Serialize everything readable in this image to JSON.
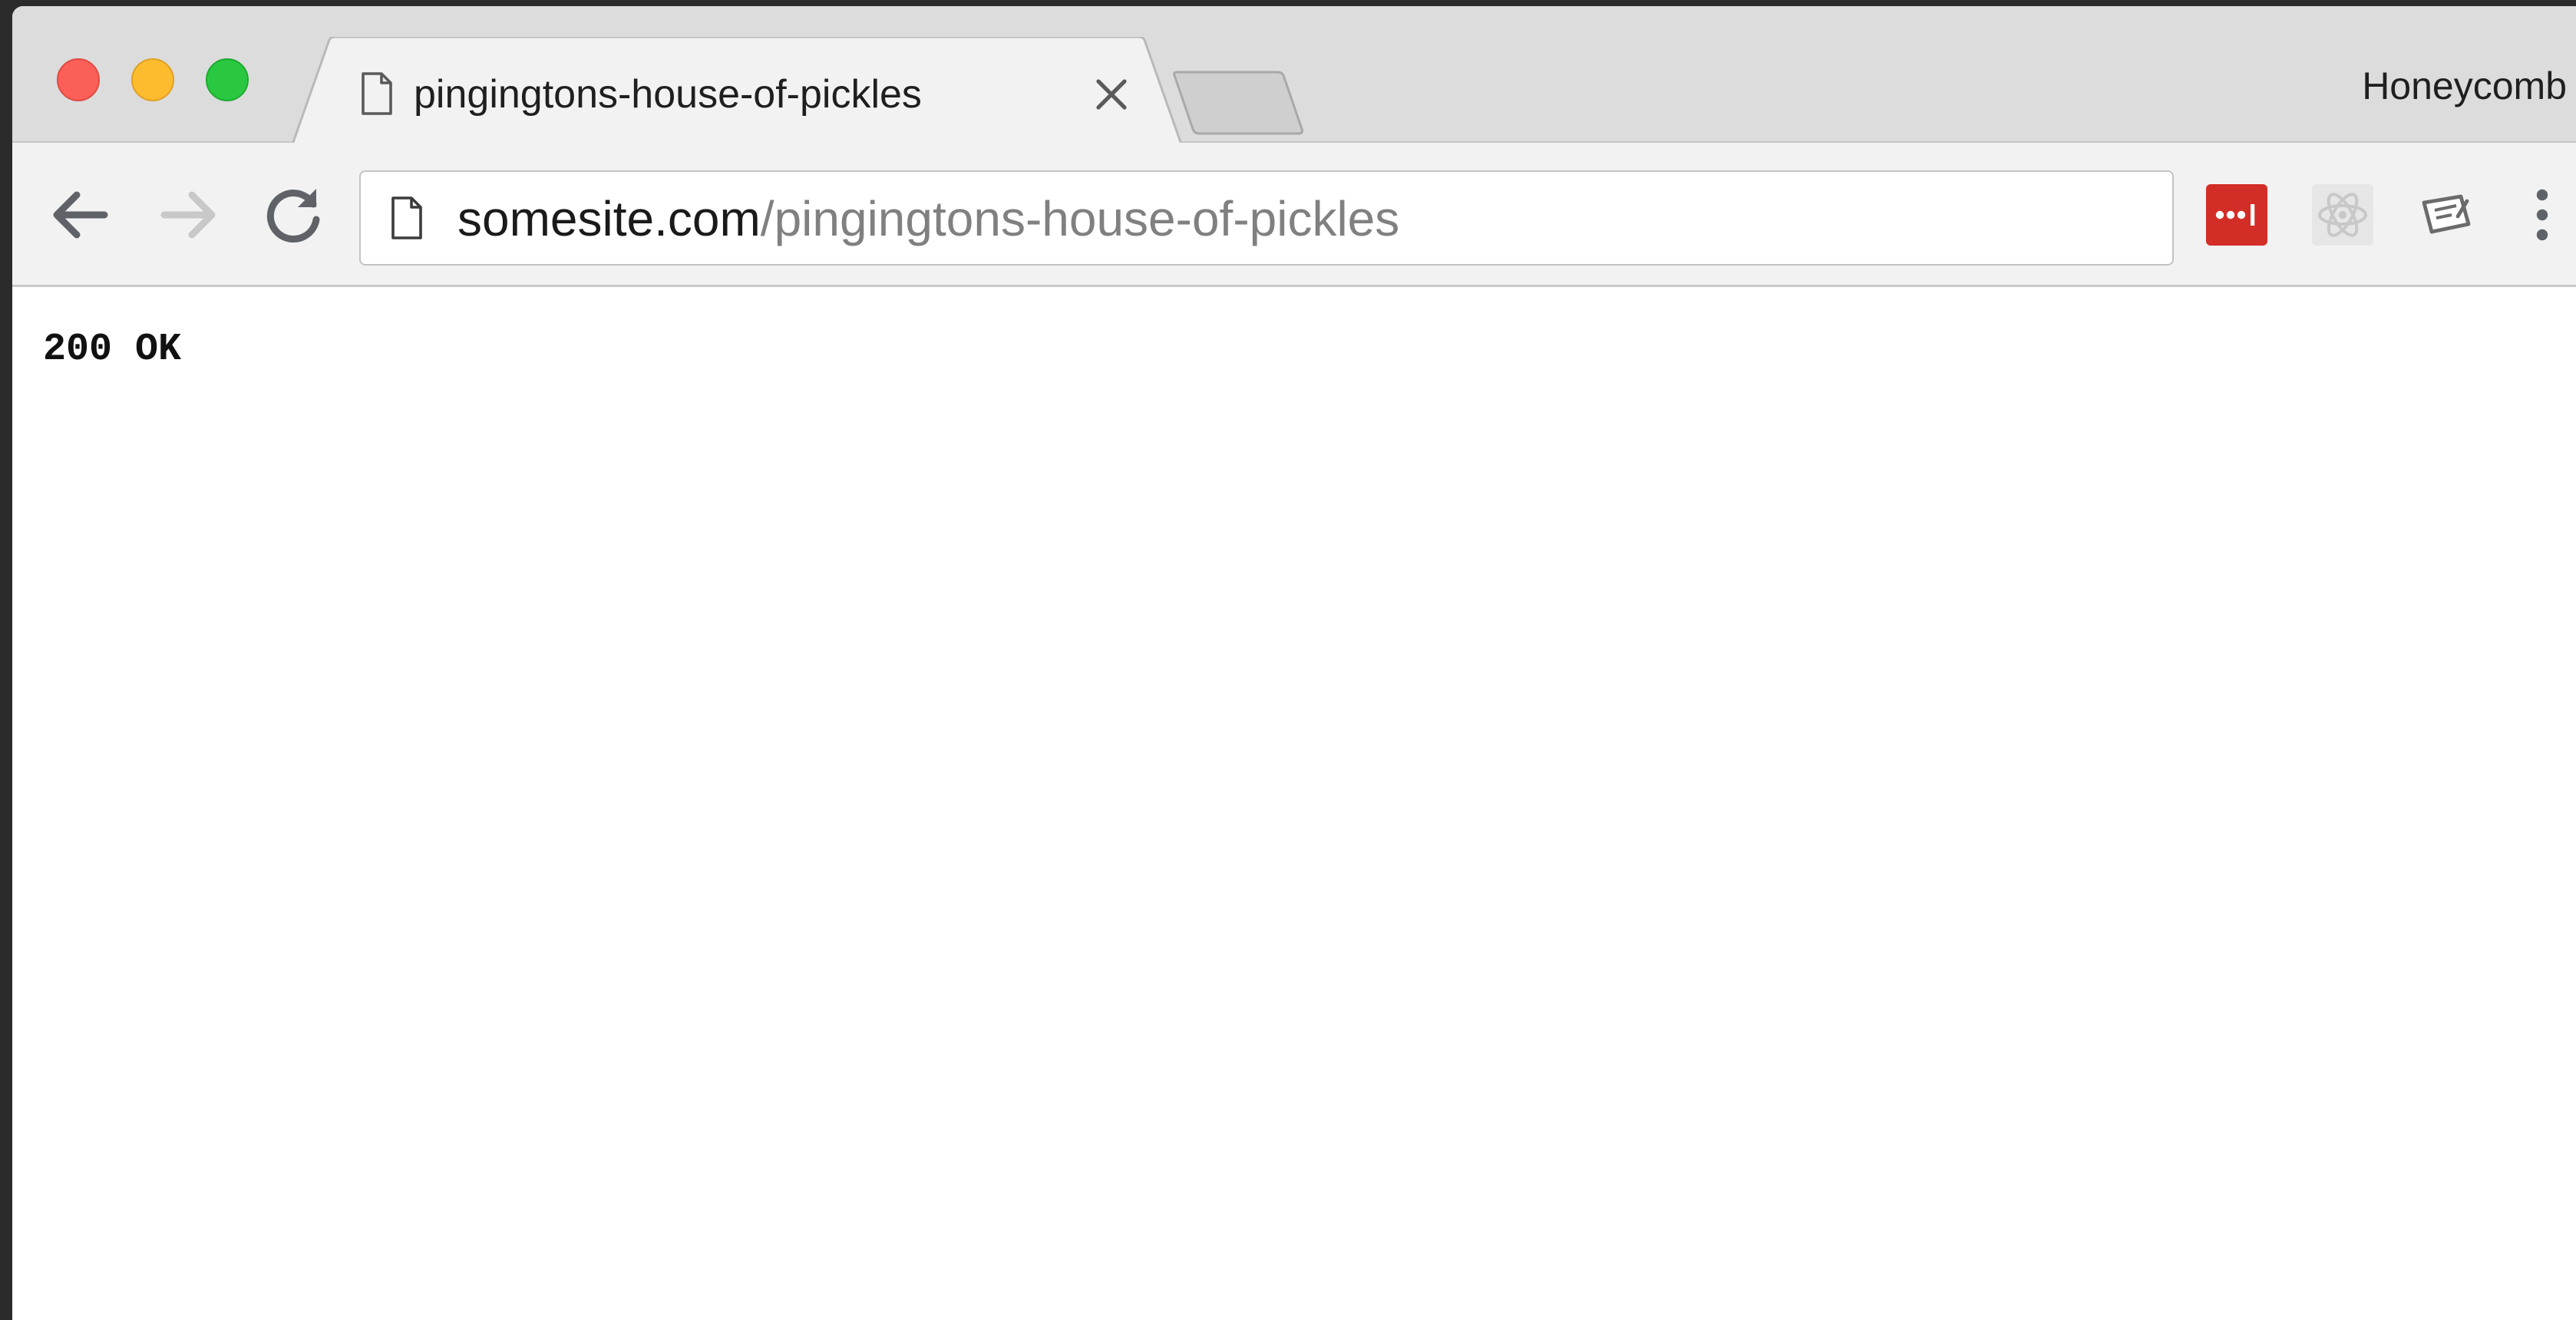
{
  "tab": {
    "title": "pingingtons-house-of-pickles",
    "icon": "page-icon",
    "close_icon": "close-icon"
  },
  "window_controls": [
    "close",
    "minimize",
    "maximize"
  ],
  "profile": {
    "name": "Honeycomb"
  },
  "toolbar": {
    "back_icon": "arrow-left-icon",
    "forward_icon": "arrow-right-icon",
    "reload_icon": "reload-icon",
    "menu_icon": "more-vertical-icon"
  },
  "address_bar": {
    "host": "somesite.com",
    "path": "/pingingtons-house-of-pickles"
  },
  "extensions": [
    {
      "name": "lastpass-icon",
      "color": "#d32d27"
    },
    {
      "name": "react-devtools-icon",
      "color": "#c8c8c8"
    },
    {
      "name": "notes-icon",
      "color": "#6b6b6b"
    }
  ],
  "page": {
    "body_text": "200 OK"
  }
}
